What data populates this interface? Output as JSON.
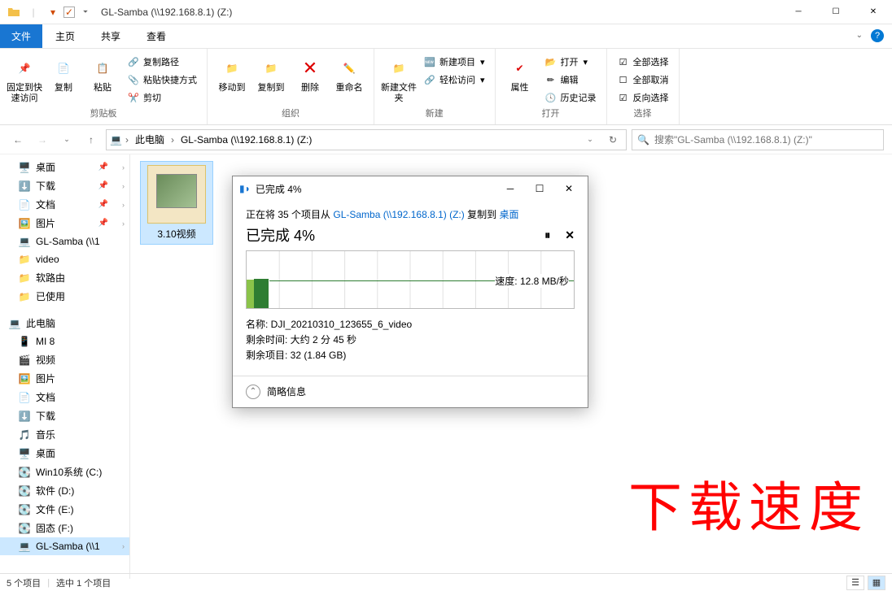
{
  "window": {
    "title": "GL-Samba (\\\\192.168.8.1) (Z:)"
  },
  "tabrow": {
    "file": "文件",
    "tabs": [
      "主页",
      "共享",
      "查看"
    ]
  },
  "ribbon": {
    "pin": "固定到快速访问",
    "copy": "复制",
    "paste": "粘贴",
    "copypath": "复制路径",
    "pasteshortcut": "粘贴快捷方式",
    "cut": "剪切",
    "clipboard_label": "剪贴板",
    "moveto": "移动到",
    "copyto": "复制到",
    "delete": "删除",
    "rename": "重命名",
    "organize_label": "组织",
    "newfolder": "新建文件夹",
    "newitem": "新建项目",
    "easyaccess": "轻松访问",
    "new_label": "新建",
    "properties": "属性",
    "open": "打开",
    "edit": "编辑",
    "history": "历史记录",
    "open_label": "打开",
    "selectall": "全部选择",
    "selectnone": "全部取消",
    "invertsel": "反向选择",
    "select_label": "选择"
  },
  "breadcrumb": {
    "root": "此电脑",
    "loc": "GL-Samba (\\\\192.168.8.1) (Z:)"
  },
  "search": {
    "placeholder": "搜索\"GL-Samba (\\\\192.168.8.1) (Z:)\""
  },
  "sidebar": [
    {
      "label": "桌面",
      "icon": "desktop",
      "pin": true,
      "chev": true
    },
    {
      "label": "下载",
      "icon": "download",
      "pin": true,
      "chev": true
    },
    {
      "label": "文档",
      "icon": "doc",
      "pin": true,
      "chev": true
    },
    {
      "label": "图片",
      "icon": "pic",
      "pin": true,
      "chev": true
    },
    {
      "label": "GL-Samba (\\\\1",
      "icon": "netdrive"
    },
    {
      "label": "video",
      "icon": "folder"
    },
    {
      "label": "软路由",
      "icon": "folder"
    },
    {
      "label": "已使用",
      "icon": "folder"
    },
    {
      "sep": true
    },
    {
      "label": "此电脑",
      "icon": "pc",
      "lv0": true
    },
    {
      "label": "MI 8",
      "icon": "phone"
    },
    {
      "label": "视频",
      "icon": "video"
    },
    {
      "label": "图片",
      "icon": "pic"
    },
    {
      "label": "文档",
      "icon": "doc"
    },
    {
      "label": "下载",
      "icon": "download"
    },
    {
      "label": "音乐",
      "icon": "music"
    },
    {
      "label": "桌面",
      "icon": "desktop"
    },
    {
      "label": "Win10系统 (C:)",
      "icon": "drive-c"
    },
    {
      "label": "软件 (D:)",
      "icon": "drive"
    },
    {
      "label": "文件 (E:)",
      "icon": "drive"
    },
    {
      "label": "固态 (F:)",
      "icon": "drive"
    },
    {
      "label": "GL-Samba (\\\\1",
      "icon": "netdrive",
      "selected": true,
      "chev": true
    }
  ],
  "content": {
    "folder_name": "3.10视频"
  },
  "dialog": {
    "title": "已完成 4%",
    "copying_prefix": "正在将 35 个项目从 ",
    "copying_src": "GL-Samba (\\\\192.168.8.1) (Z:)",
    "copying_mid": " 复制到 ",
    "copying_dst": "桌面",
    "progress_label": "已完成 4%",
    "speed_label": "速度: 12.8 MB/秒",
    "name_label": "名称: ",
    "name_value": "DJI_20210310_123655_6_video",
    "remaining_label": "剩余时间: ",
    "remaining_value": "大约 2 分 45 秒",
    "items_label": "剩余项目: ",
    "items_value": "32 (1.84 GB)",
    "brief": "简略信息"
  },
  "chart_data": {
    "type": "area",
    "title": "",
    "xlabel": "",
    "ylabel": "",
    "ylim": [
      0,
      25
    ],
    "series": [
      {
        "name": "speed_MBps",
        "values": [
          12.5,
          12.8,
          13.0
        ]
      }
    ],
    "annotation": "速度: 12.8 MB/秒"
  },
  "statusbar": {
    "count": "5 个项目",
    "selected": "选中 1 个项目"
  },
  "overlay": "下载速度"
}
